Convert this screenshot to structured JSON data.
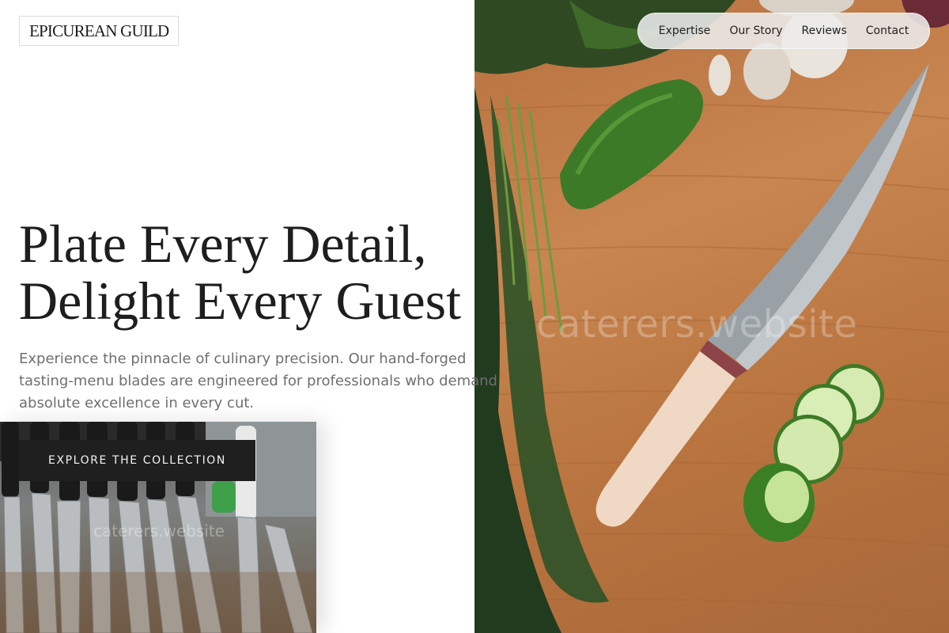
{
  "brand": {
    "logo_text": "EPICUREAN GUILD"
  },
  "nav": {
    "items": [
      {
        "label": "Expertise"
      },
      {
        "label": "Our Story"
      },
      {
        "label": "Reviews"
      },
      {
        "label": "Contact"
      }
    ]
  },
  "hero": {
    "headline_line1": "Plate Every Detail,",
    "headline_line2": "Delight Every Guest",
    "subtext_line1": "Experience the pinnacle of culinary precision. Our hand-forged",
    "subtext_line2": "tasting-menu blades are engineered for professionals who demand",
    "subtext_line3": "absolute excellence in every cut.",
    "cta_label": "EXPLORE THE COLLECTION"
  },
  "images": {
    "main_watermark": "caterers.website",
    "secondary_watermark": "caterers.website"
  },
  "colors": {
    "cta_background": "#1f1f1f",
    "headline": "#1e1e1e",
    "subtext": "#6f6f6f",
    "nav_pill": "#ececec"
  }
}
